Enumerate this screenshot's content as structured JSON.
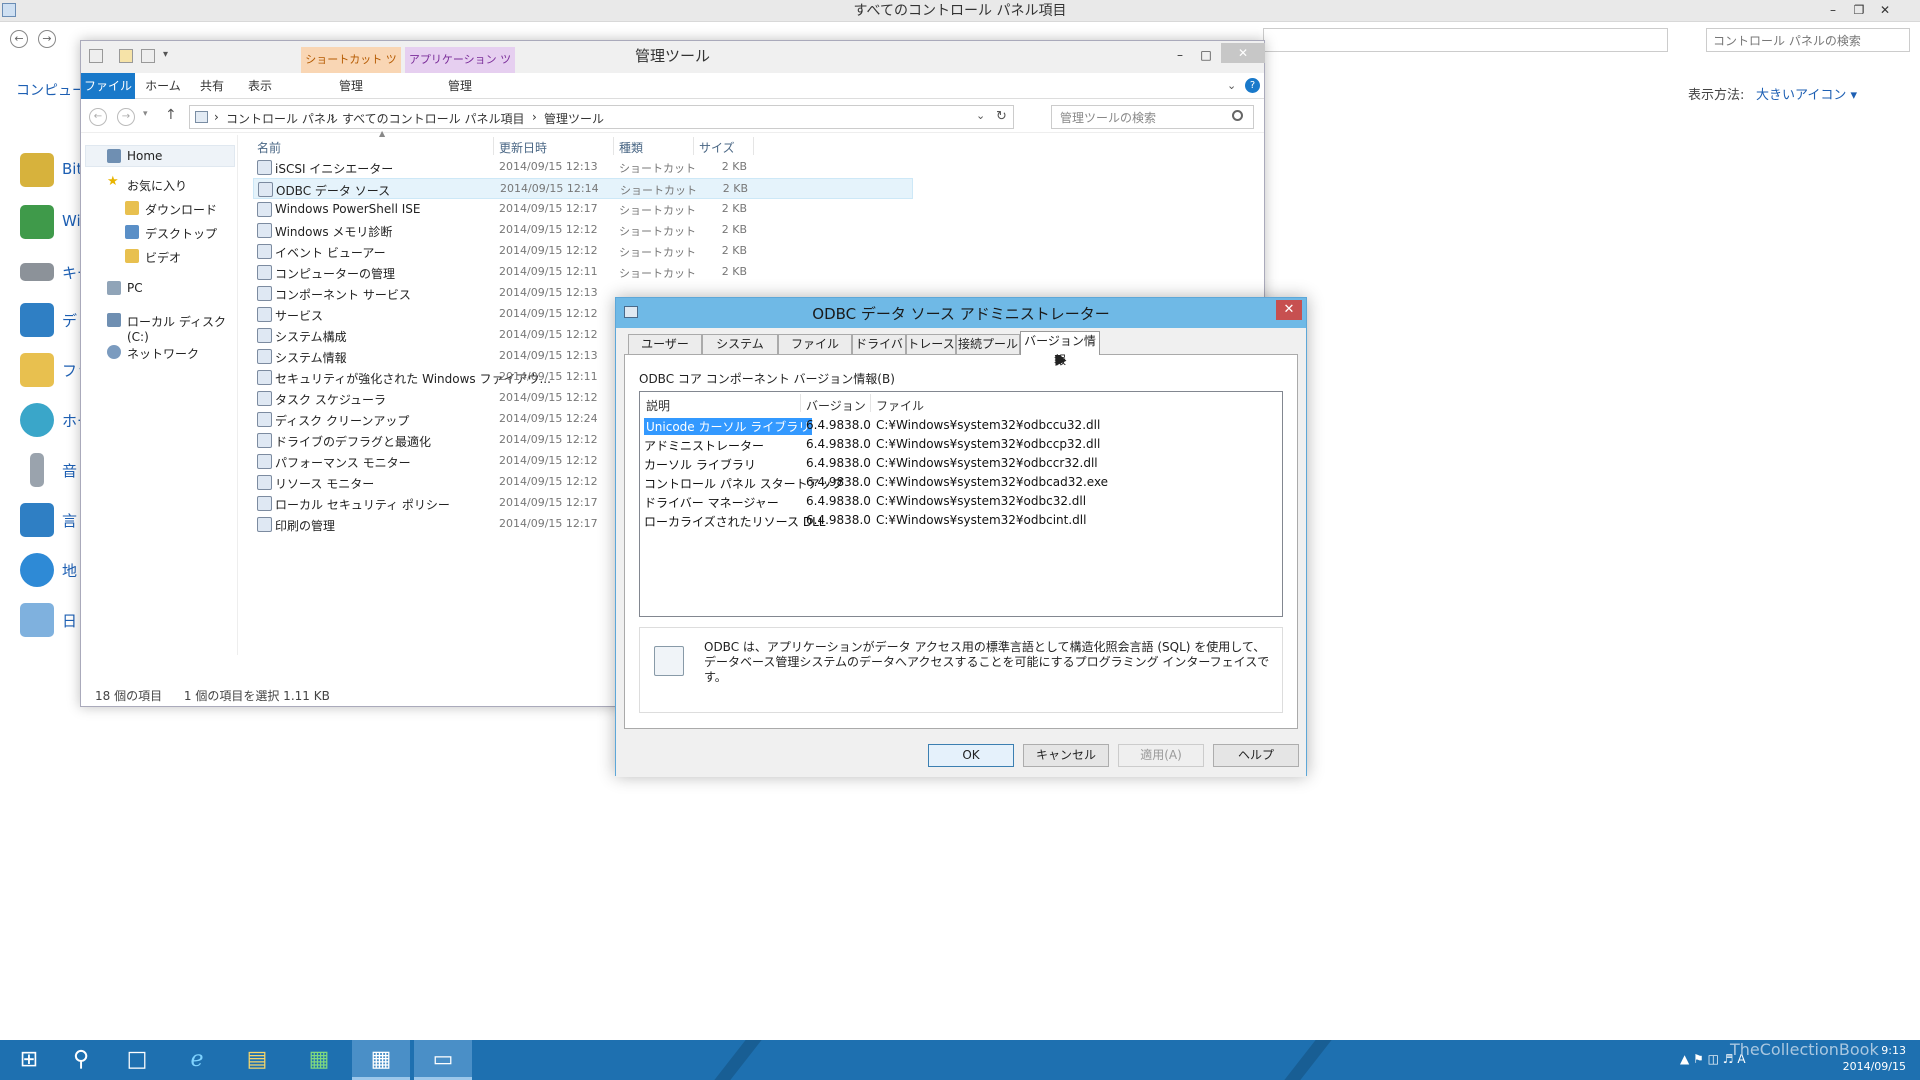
{
  "cp": {
    "title": "すべてのコントロール パネル項目",
    "search_placeholder": "コントロール パネルの検索",
    "view_by_label": "表示方法:",
    "view_by_value": "大きいアイコン ▾",
    "left_label": "コンピューター",
    "items": [
      "Bit",
      "Wi",
      "キー",
      "デ",
      "ファ",
      "ホー",
      "音",
      "言",
      "地",
      "日"
    ]
  },
  "explorer": {
    "title": "管理ツール",
    "ctx_tab1": "ショートカット ツール",
    "ctx_tab2": "アプリケーション ツール",
    "ribbon_tabs": [
      "ファイル",
      "ホーム",
      "共有",
      "表示",
      "管理",
      "管理"
    ],
    "breadcrumb": [
      "コントロール パネル",
      "すべてのコントロール パネル項目",
      "管理ツール"
    ],
    "search_placeholder": "管理ツールの検索",
    "nav": [
      "Home",
      "お気に入り",
      "ダウンロード",
      "デスクトップ",
      "ビデオ",
      "PC",
      "ローカル ディスク (C:)",
      "ネットワーク"
    ],
    "columns": [
      "名前",
      "更新日時",
      "種類",
      "サイズ"
    ],
    "files": [
      {
        "name": "iSCSI イニシエーター",
        "date": "2014/09/15 12:13",
        "type": "ショートカット",
        "size": "2 KB"
      },
      {
        "name": "ODBC データ ソース",
        "date": "2014/09/15 12:14",
        "type": "ショートカット",
        "size": "2 KB"
      },
      {
        "name": "Windows PowerShell ISE",
        "date": "2014/09/15 12:17",
        "type": "ショートカット",
        "size": "2 KB"
      },
      {
        "name": "Windows メモリ診断",
        "date": "2014/09/15 12:12",
        "type": "ショートカット",
        "size": "2 KB"
      },
      {
        "name": "イベント ビューアー",
        "date": "2014/09/15 12:12",
        "type": "ショートカット",
        "size": "2 KB"
      },
      {
        "name": "コンピューターの管理",
        "date": "2014/09/15 12:11",
        "type": "ショートカット",
        "size": "2 KB"
      },
      {
        "name": "コンポーネント サービス",
        "date": "2014/09/15 12:13",
        "type": "",
        "size": ""
      },
      {
        "name": "サービス",
        "date": "2014/09/15 12:12",
        "type": "",
        "size": ""
      },
      {
        "name": "システム構成",
        "date": "2014/09/15 12:12",
        "type": "",
        "size": ""
      },
      {
        "name": "システム情報",
        "date": "2014/09/15 12:13",
        "type": "",
        "size": ""
      },
      {
        "name": "セキュリティが強化された Windows ファイアウ...",
        "date": "2014/09/15 12:11",
        "type": "",
        "size": ""
      },
      {
        "name": "タスク スケジューラ",
        "date": "2014/09/15 12:12",
        "type": "",
        "size": ""
      },
      {
        "name": "ディスク クリーンアップ",
        "date": "2014/09/15 12:24",
        "type": "",
        "size": ""
      },
      {
        "name": "ドライブのデフラグと最適化",
        "date": "2014/09/15 12:12",
        "type": "",
        "size": ""
      },
      {
        "name": "パフォーマンス モニター",
        "date": "2014/09/15 12:12",
        "type": "",
        "size": ""
      },
      {
        "name": "リソース モニター",
        "date": "2014/09/15 12:12",
        "type": "",
        "size": ""
      },
      {
        "name": "ローカル セキュリティ ポリシー",
        "date": "2014/09/15 12:17",
        "type": "",
        "size": ""
      },
      {
        "name": "印刷の管理",
        "date": "2014/09/15 12:17",
        "type": "",
        "size": ""
      }
    ],
    "status_count": "18 個の項目",
    "status_sel": "1 個の項目を選択  1.11 KB"
  },
  "dialog": {
    "title": "ODBC データ ソース アドミニストレーター",
    "tabs": [
      "ユーザー DSN",
      "システム DSN",
      "ファイル DSN",
      "ドライバー",
      "トレース",
      "接続プール",
      "バージョン情報"
    ],
    "group_label": "ODBC コア コンポーネント バージョン情報(B)",
    "columns": [
      "説明",
      "バージョン",
      "ファイル"
    ],
    "rows": [
      {
        "desc": "Unicode カーソル ライブラリ",
        "ver": "6.4.9838.0",
        "file": "C:¥Windows¥system32¥odbccu32.dll"
      },
      {
        "desc": "アドミニストレーター",
        "ver": "6.4.9838.0",
        "file": "C:¥Windows¥system32¥odbccp32.dll"
      },
      {
        "desc": "カーソル ライブラリ",
        "ver": "6.4.9838.0",
        "file": "C:¥Windows¥system32¥odbccr32.dll"
      },
      {
        "desc": "コントロール パネル スタートアップ",
        "ver": "6.4.9838.0",
        "file": "C:¥Windows¥system32¥odbcad32.exe"
      },
      {
        "desc": "ドライバー マネージャー",
        "ver": "6.4.9838.0",
        "file": "C:¥Windows¥system32¥odbc32.dll"
      },
      {
        "desc": "ローカライズされたリソース DLL",
        "ver": "6.4.9838.0",
        "file": "C:¥Windows¥system32¥odbcint.dll"
      }
    ],
    "info_text": "ODBC は、アプリケーションがデータ アクセス用の標準言語として構造化照会言語 (SQL) を使用して、データベース管理システムのデータへアクセスすることを可能にするプログラミング インターフェイスです。",
    "buttons": {
      "ok": "OK",
      "cancel": "キャンセル",
      "apply": "適用(A)",
      "help": "ヘルプ"
    }
  },
  "taskbar": {
    "time": "9:13",
    "date": "2014/09/15",
    "watermark": "TheCollectionBook"
  },
  "colors": {
    "accent": "#1979ca",
    "dialog_title": "#6fb9e6",
    "taskbar": "#1e70b0",
    "selection": "#3399ff"
  }
}
